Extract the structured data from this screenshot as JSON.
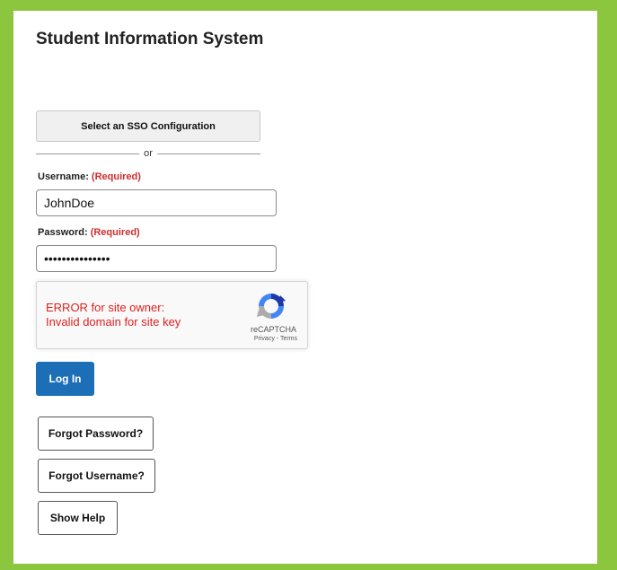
{
  "page": {
    "title": "Student Information System"
  },
  "sso": {
    "button_label": "Select an SSO Configuration",
    "divider_text": "or"
  },
  "username": {
    "label": "Username:",
    "required": "(Required)",
    "value": "JohnDoe"
  },
  "password": {
    "label": "Password:",
    "required": "(Required)",
    "masked_value": "•••••••••••••••"
  },
  "recaptcha": {
    "error_line1": "ERROR for site owner:",
    "error_line2": "Invalid domain for site key",
    "brand": "reCAPTCHA",
    "privacy_link": "Privacy",
    "separator": " - ",
    "terms_link": "Terms",
    "logo_icon": "recaptcha-logo-icon"
  },
  "actions": {
    "login_label": "Log In",
    "forgot_password_label": "Forgot Password?",
    "forgot_username_label": "Forgot Username?",
    "show_help_label": "Show Help"
  },
  "colors": {
    "page_background": "#8cc63f",
    "required_text": "#d02d2d",
    "primary_button": "#1c6fb7",
    "captcha_error": "#e41e1e"
  }
}
